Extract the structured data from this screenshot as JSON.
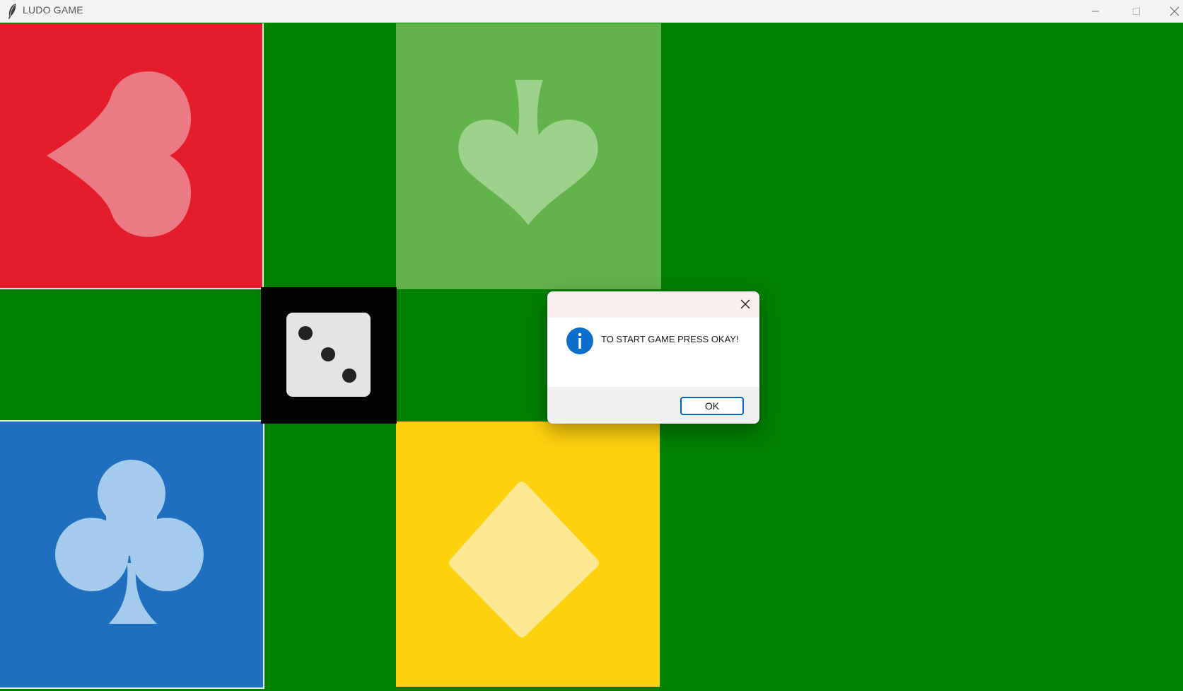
{
  "window": {
    "title": "LUDO GAME",
    "app_icon": "feather-icon",
    "controls": [
      "minimize-icon",
      "maximize-icon",
      "close-icon"
    ]
  },
  "board": {
    "background_color": "#008000",
    "homes": [
      {
        "color_name": "red",
        "color": "#e31e2a",
        "suit_icon": "heart-icon",
        "suit_color": "#ec7a82"
      },
      {
        "color_name": "green",
        "color": "#62b34b",
        "suit_icon": "spade-icon",
        "suit_color": "#9dd28c"
      },
      {
        "color_name": "blue",
        "color": "#1f6fbe",
        "suit_icon": "club-icon",
        "suit_color": "#a5cbec"
      },
      {
        "color_name": "yellow",
        "color": "#fdd10e",
        "suit_icon": "diamond-icon",
        "suit_color": "#fde793"
      }
    ],
    "dice": {
      "value": 3,
      "icon": "dice-three-icon"
    }
  },
  "dialog": {
    "icon": "info-icon",
    "message": "TO START GAME PRESS OKAY!",
    "ok_label": "OK",
    "close_icon": "close-icon"
  }
}
